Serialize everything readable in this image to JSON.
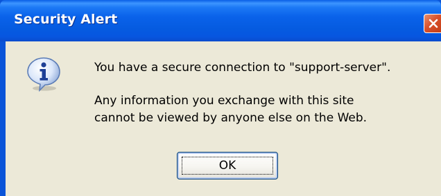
{
  "window": {
    "title": "Security Alert"
  },
  "dialog": {
    "icon": "information-icon",
    "message_line1": "You have a secure connection to \"support-server\".",
    "message_line2": "Any information you exchange with this site",
    "message_line3": "cannot be viewed by anyone else on the Web.",
    "ok_label": "OK"
  },
  "colors": {
    "titlebar": "#0a5fe6",
    "client_background": "#ece9d8",
    "close_button": "#d8502b",
    "button_border": "#003c74"
  }
}
